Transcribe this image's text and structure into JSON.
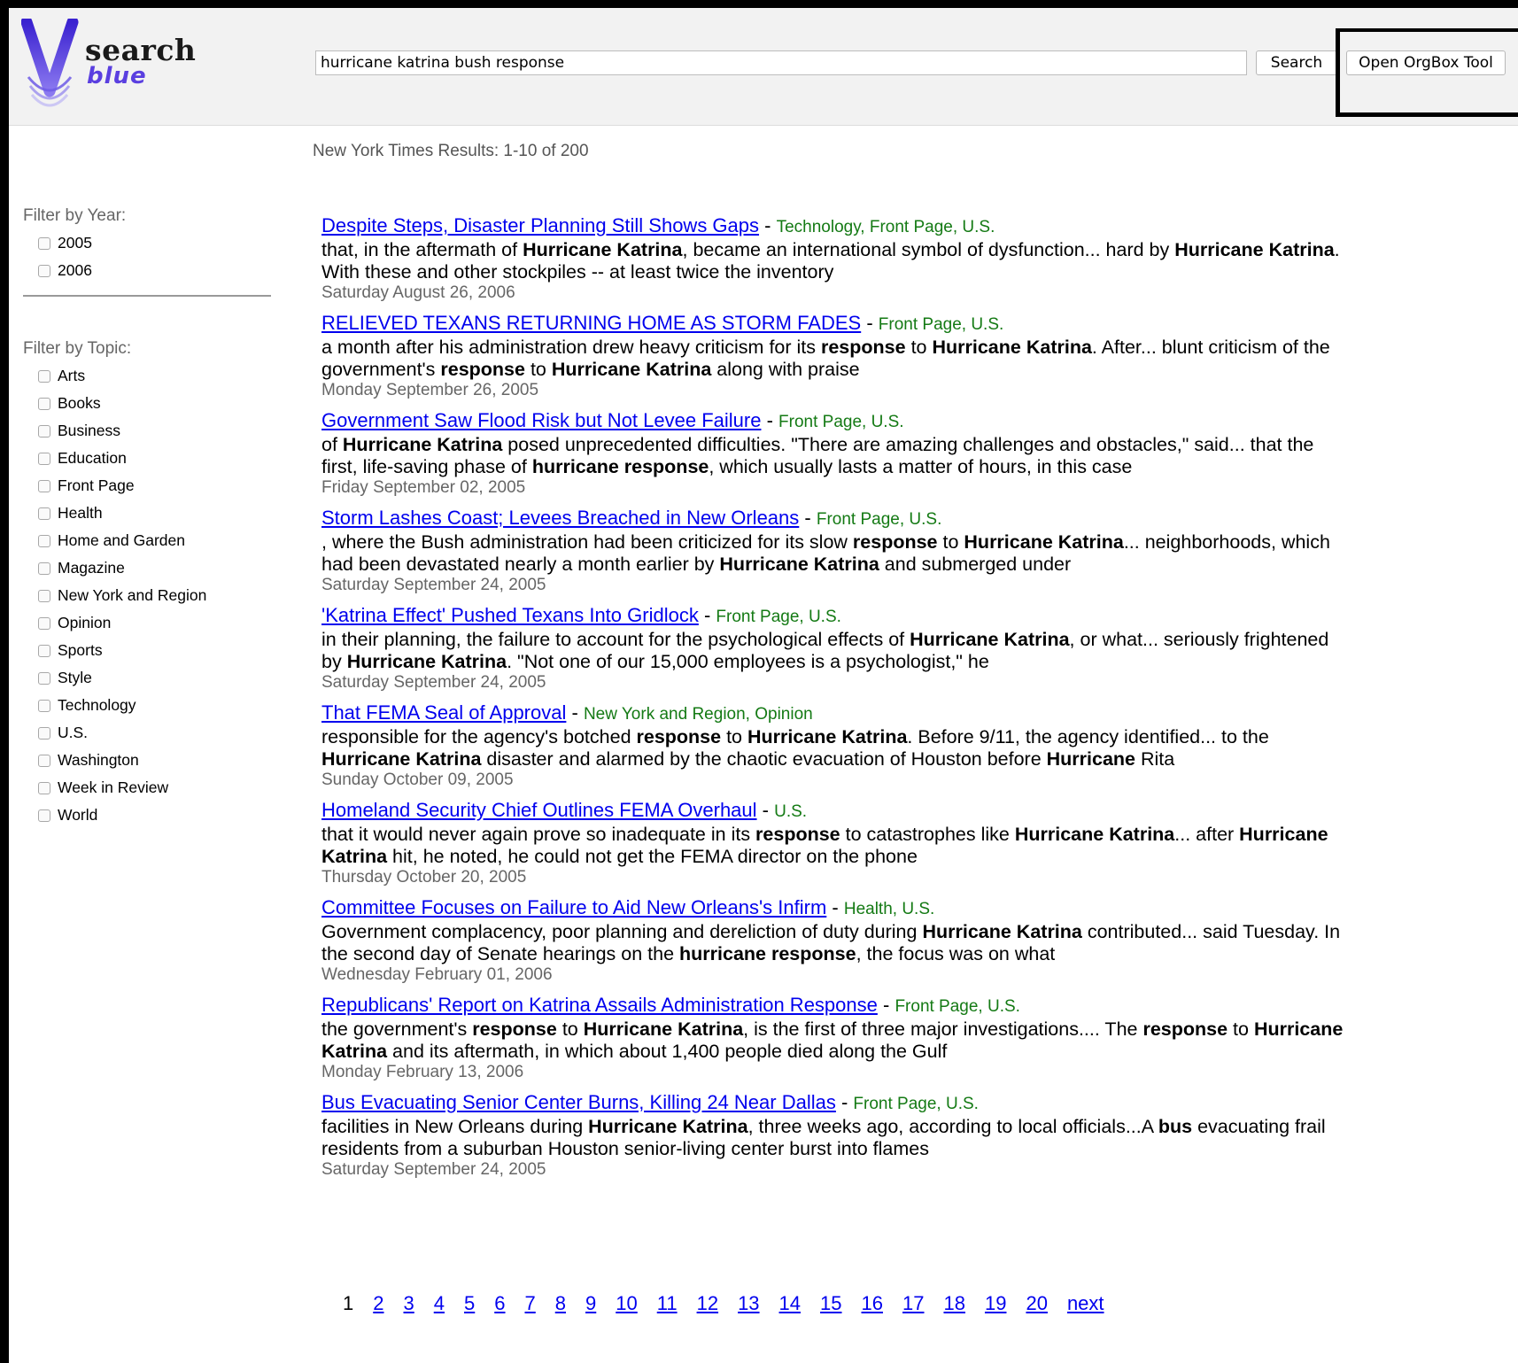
{
  "app": {
    "logo_word1": "search",
    "logo_word2": "blue"
  },
  "search": {
    "query": "hurricane katrina bush response",
    "search_button": "Search",
    "orgbox_button": "Open OrgBox Tool"
  },
  "results_summary": "New York Times Results: 1-10 of 200",
  "filters": {
    "year_title": "Filter by Year:",
    "years": [
      "2005",
      "2006"
    ],
    "topic_title": "Filter by Topic:",
    "topics": [
      "Arts",
      "Books",
      "Business",
      "Education",
      "Front Page",
      "Health",
      "Home and Garden",
      "Magazine",
      "New York and Region",
      "Opinion",
      "Sports",
      "Style",
      "Technology",
      "U.S.",
      "Washington",
      "Week in Review",
      "World"
    ]
  },
  "results": [
    {
      "title": "Despite Steps, Disaster Planning Still Shows Gaps",
      "topics": "Technology, Front Page, U.S.",
      "snippet": [
        {
          "t": "that, in the aftermath of "
        },
        {
          "b": "Hurricane Katrina"
        },
        {
          "t": ", became an international symbol of dysfunction... hard by "
        },
        {
          "b": "Hurricane Katrina"
        },
        {
          "t": ". With these and other stockpiles -- at least twice the inventory"
        }
      ],
      "date": "Saturday August 26, 2006"
    },
    {
      "title": "RELIEVED TEXANS RETURNING HOME AS STORM FADES",
      "topics": "Front Page, U.S.",
      "snippet": [
        {
          "t": "a month after his administration drew heavy criticism for its "
        },
        {
          "b": "response"
        },
        {
          "t": " to "
        },
        {
          "b": "Hurricane Katrina"
        },
        {
          "t": ". After... blunt criticism of the government's "
        },
        {
          "b": "response"
        },
        {
          "t": " to "
        },
        {
          "b": "Hurricane Katrina"
        },
        {
          "t": " along with praise"
        }
      ],
      "date": "Monday September 26, 2005"
    },
    {
      "title": "Government Saw Flood Risk but Not Levee Failure",
      "topics": "Front Page, U.S.",
      "snippet": [
        {
          "t": "of "
        },
        {
          "b": "Hurricane Katrina"
        },
        {
          "t": " posed unprecedented difficulties. \"There are amazing challenges and obstacles,\" said... that the first, life-saving phase of "
        },
        {
          "b": "hurricane response"
        },
        {
          "t": ", which usually lasts a matter of hours, in this case"
        }
      ],
      "date": "Friday September 02, 2005"
    },
    {
      "title": "Storm Lashes Coast; Levees Breached in New Orleans",
      "topics": "Front Page, U.S.",
      "snippet": [
        {
          "t": ", where the Bush administration had been criticized for its slow "
        },
        {
          "b": "response"
        },
        {
          "t": " to "
        },
        {
          "b": "Hurricane Katrina"
        },
        {
          "t": "... neighborhoods, which had been devastated nearly a month earlier by "
        },
        {
          "b": "Hurricane Katrina"
        },
        {
          "t": " and submerged under"
        }
      ],
      "date": "Saturday September 24, 2005"
    },
    {
      "title": "'Katrina Effect' Pushed Texans Into Gridlock",
      "topics": "Front Page, U.S.",
      "snippet": [
        {
          "t": "in their planning, the failure to account for the psychological effects of "
        },
        {
          "b": "Hurricane Katrina"
        },
        {
          "t": ", or what... seriously frightened by "
        },
        {
          "b": "Hurricane Katrina"
        },
        {
          "t": ". \"Not one of our 15,000 employees is a psychologist,\" he"
        }
      ],
      "date": "Saturday September 24, 2005"
    },
    {
      "title": "That FEMA Seal of Approval",
      "topics": "New York and Region, Opinion",
      "snippet": [
        {
          "t": "responsible for the agency's botched "
        },
        {
          "b": "response"
        },
        {
          "t": " to "
        },
        {
          "b": "Hurricane Katrina"
        },
        {
          "t": ". Before 9/11, the agency identified... to the "
        },
        {
          "b": "Hurricane Katrina"
        },
        {
          "t": " disaster and alarmed by the chaotic evacuation of Houston before "
        },
        {
          "b": "Hurricane"
        },
        {
          "t": " Rita"
        }
      ],
      "date": "Sunday October 09, 2005"
    },
    {
      "title": "Homeland Security Chief Outlines FEMA Overhaul",
      "topics": "U.S.",
      "snippet": [
        {
          "t": "that it would never again prove so inadequate in its "
        },
        {
          "b": "response"
        },
        {
          "t": " to catastrophes like "
        },
        {
          "b": "Hurricane Katrina"
        },
        {
          "t": "... after "
        },
        {
          "b": "Hurricane Katrina"
        },
        {
          "t": " hit, he noted, he could not get the FEMA director on the phone"
        }
      ],
      "date": "Thursday October 20, 2005"
    },
    {
      "title": "Committee Focuses on Failure to Aid New Orleans's Infirm",
      "topics": "Health, U.S.",
      "snippet": [
        {
          "t": "Government complacency, poor planning and dereliction of duty during "
        },
        {
          "b": "Hurricane Katrina"
        },
        {
          "t": " contributed... said Tuesday. In the second day of Senate hearings on the "
        },
        {
          "b": "hurricane response"
        },
        {
          "t": ", the focus was on what"
        }
      ],
      "date": "Wednesday February 01, 2006"
    },
    {
      "title": "Republicans' Report on Katrina Assails Administration Response",
      "topics": "Front Page, U.S.",
      "snippet": [
        {
          "t": "the government's "
        },
        {
          "b": "response"
        },
        {
          "t": " to "
        },
        {
          "b": "Hurricane Katrina"
        },
        {
          "t": ", is the first of three major investigations.... The "
        },
        {
          "b": "response"
        },
        {
          "t": " to "
        },
        {
          "b": "Hurricane Katrina"
        },
        {
          "t": " and its aftermath, in which about 1,400 people died along the Gulf"
        }
      ],
      "date": "Monday February 13, 2006"
    },
    {
      "title": "Bus Evacuating Senior Center Burns, Killing 24 Near Dallas",
      "topics": "Front Page, U.S.",
      "snippet": [
        {
          "t": "facilities in New Orleans during "
        },
        {
          "b": "Hurricane Katrina"
        },
        {
          "t": ", three weeks ago, according to local officials...A "
        },
        {
          "b": "bus"
        },
        {
          "t": " evacuating frail residents from a suburban Houston senior-living center burst into flames"
        }
      ],
      "date": "Saturday September 24, 2005"
    }
  ],
  "pagination": {
    "current": "1",
    "pages": [
      "2",
      "3",
      "4",
      "5",
      "6",
      "7",
      "8",
      "9",
      "10",
      "11",
      "12",
      "13",
      "14",
      "15",
      "16",
      "17",
      "18",
      "19",
      "20"
    ],
    "next": "next"
  },
  "colors": {
    "link": "#0000ee",
    "topic": "#147a14",
    "header_bg": "#f2f2f2",
    "logo_accent": "#5a3fe0"
  }
}
